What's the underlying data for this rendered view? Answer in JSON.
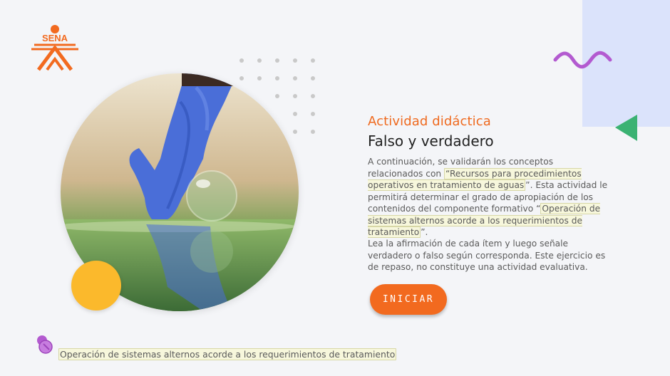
{
  "header": {
    "logo_text": "SENA",
    "brand_color": "#f26a1f"
  },
  "activity": {
    "kicker": "Actividad didáctica",
    "title": "Falso y verdadero"
  },
  "paragraph1": {
    "t1": "A continuación, se validarán los conceptos relacionados con ",
    "h1": "“Recursos para procedimientos operativos en tratamiento de aguas",
    "t2": "”.  Esta actividad le permitirá determinar el grado de apropiación de los contenidos del componente formativo “",
    "h2": "Operación de sistemas alternos acorde a los requerimientos de tratamiento",
    "t3": "”."
  },
  "paragraph2": "Lea la afirmación de cada ítem y luego señale verdadero o falso según corresponda.  Este ejercicio es de repaso, no constituye una actividad evaluativa.",
  "button": {
    "label": "INICIAR"
  },
  "footer": {
    "text": "Operación de sistemas alternos acorde a los requerimientos de tratamiento",
    "icon": "pushpin-icon"
  },
  "colors": {
    "accent": "#f26a1f",
    "yellow": "#fbb92c",
    "green": "#3bb273",
    "purple": "#b35ad0",
    "light_blue": "#dbe3fb"
  }
}
